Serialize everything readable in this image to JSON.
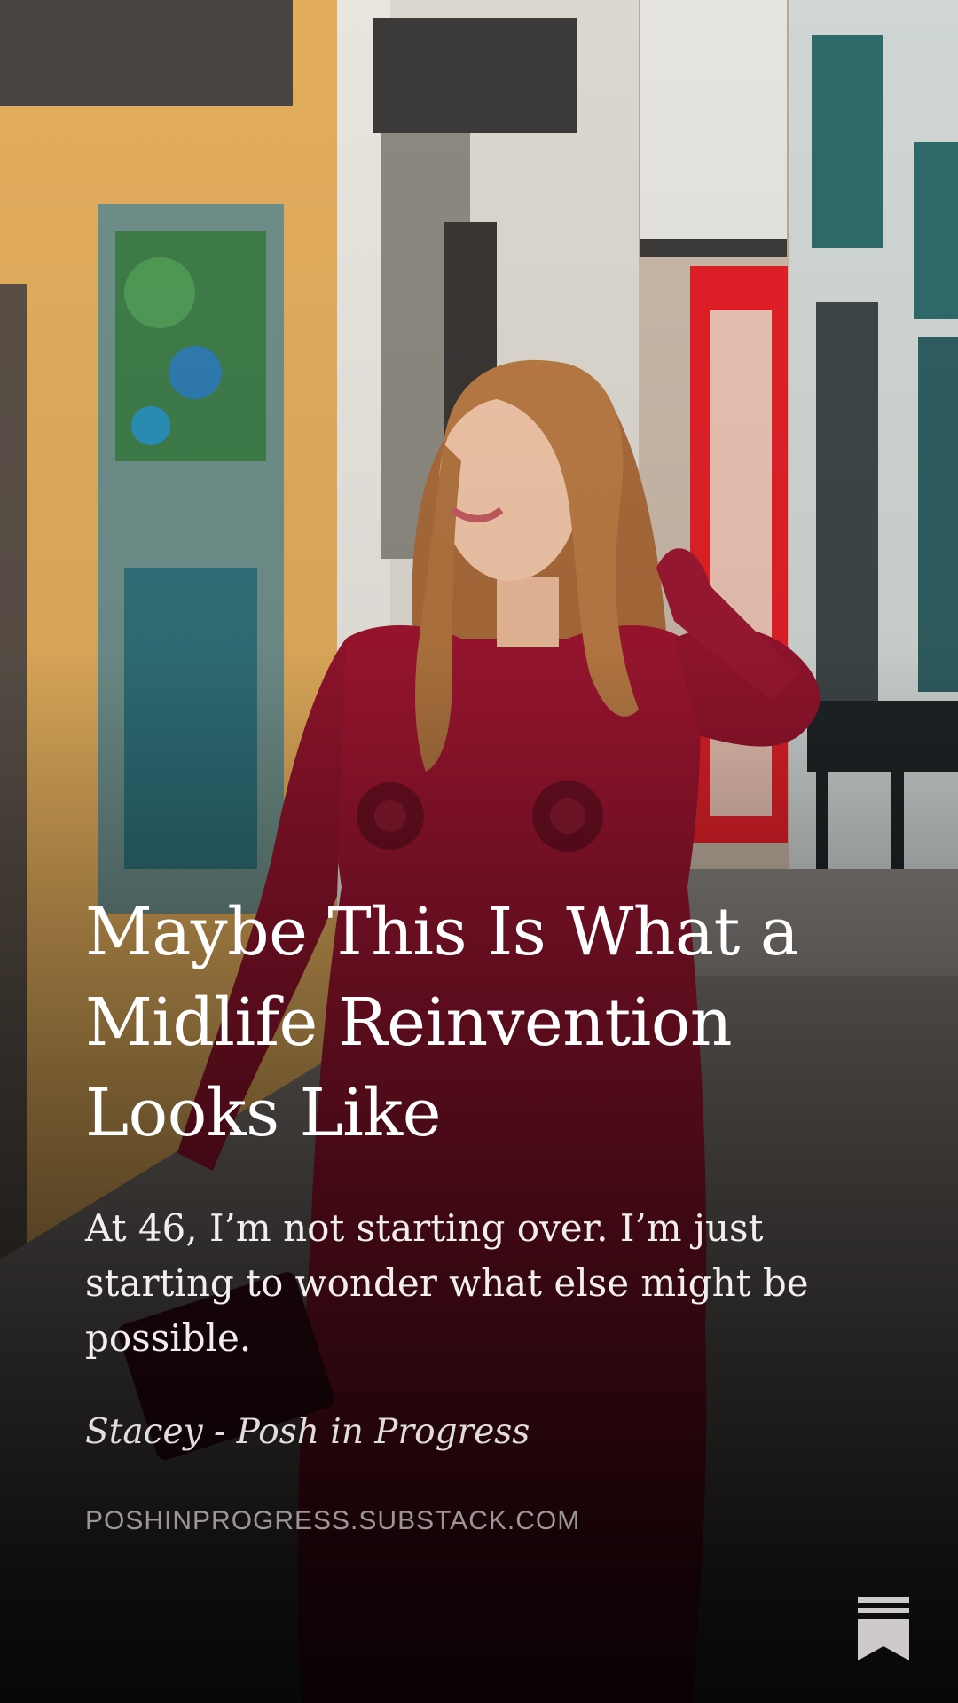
{
  "post": {
    "title": "Maybe This Is What a Midlife Reinvention Looks Like",
    "subtitle": "At 46, I’m not starting over. I’m just starting to wonder what else might be possible.",
    "author": "Stacey - Posh in Progress",
    "domain": "POSHINPROGRESS.SUBSTACK.COM"
  },
  "icons": {
    "logo": "substack-bookmark-icon"
  },
  "colors": {
    "title_text": "#ffffff",
    "domain_text": "#9c9696",
    "dress": "#9c1530",
    "storefront_yellow": "#e8b25a",
    "storefront_red": "#e0202a"
  }
}
